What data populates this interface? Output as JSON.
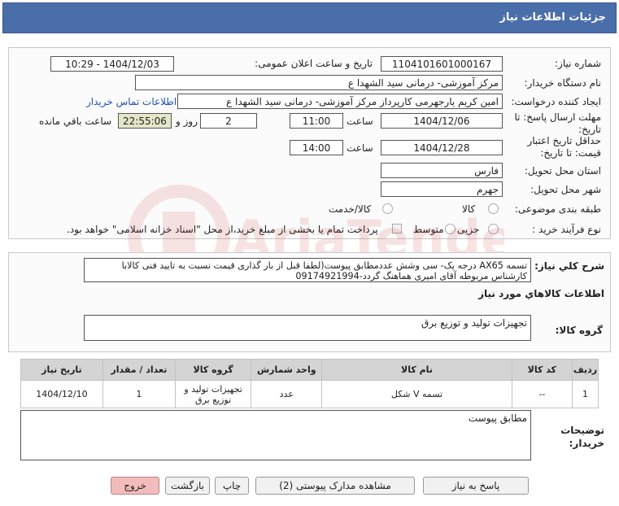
{
  "header": {
    "title": "جزئیات اطلاعات نیاز"
  },
  "form": {
    "need_number": {
      "label": "شماره نیاز:",
      "value": "1104101601000167"
    },
    "announce_datetime": {
      "label": "تاریخ و ساعت اعلان عمومی:",
      "value": "1404/12/03 - 10:29"
    },
    "buyer_org": {
      "label": "نام دستگاه خریدار:",
      "value": "مرکز آموزشی- درمانی سید الشهدا ع"
    },
    "requester": {
      "label": "ایجاد کننده درخواست:",
      "value": "امین کریم یارجهرمی کارپرداز مرکز آموزشی- درمانی سید الشهدا ع",
      "contact_link": "اطلاعات تماس خریدار"
    },
    "reply_deadline": {
      "label": "مهلت ارسال پاسخ: تا تاریخ:",
      "date": "1404/12/06",
      "time_label": "ساعت",
      "time": "11:00",
      "days": "2",
      "days_label": "روز و",
      "remaining": "22:55:06",
      "remaining_label": "ساعت باقي مانده"
    },
    "price_validity": {
      "label": "حداقل تاریخ اعتبار قیمت: تا تاریخ:",
      "date": "1404/12/28",
      "time_label": "ساعت",
      "time": "14:00"
    },
    "province": {
      "label": "استان محل تحویل:",
      "value": "فارس"
    },
    "city": {
      "label": "شهر محل تحویل:",
      "value": "جهرم"
    },
    "category": {
      "label": "طبقه بندی موضوعی:",
      "options": [
        "کالا",
        "کالا/خدمت"
      ]
    },
    "process": {
      "label": "نوع فرآیند خرید :",
      "options": [
        "جزیی",
        "متوسط"
      ],
      "payment_note": "پرداخت تمام یا بخشی از مبلغ خرید،از محل \"اسناد خزانه اسلامی\" خواهد بود."
    }
  },
  "summary": {
    "label": "شرح کلي نياز:",
    "line1": "تسمه AX65 درجه یک- سی وشش عددمطابق پیوست(لطفا قبل از بار گذاری قیمت نسبت به تایید فنی کالابا",
    "line2": "کارشناس مربوطه آقای امیری هماهنگ گردد-09174921994"
  },
  "goods_section": {
    "title": "اطلاعات کالاهاي مورد نياز"
  },
  "goods_group": {
    "label": "گروه کالا:",
    "value": "تجهیزات تولید و توزیع برق"
  },
  "table": {
    "headers": [
      "ردیف",
      "کد کالا",
      "نام کالا",
      "واحد شمارش",
      "گروه کالا",
      "تعداد / مقدار",
      "تاریخ نیاز"
    ],
    "rows": [
      {
        "row": "1",
        "code": "--",
        "name": "تسمه V شکل",
        "unit": "عدد",
        "group": "تجهیزات تولید و توزیع برق",
        "qty": "1",
        "date": "1404/12/10"
      }
    ]
  },
  "buyer_notes": {
    "label": "توضیحات خریدار:",
    "value": "مطابق پیوست"
  },
  "buttons": {
    "reply": "پاسخ به نیاز",
    "attachments": "مشاهده مدارک پیوستی (2)",
    "print": "چاپ",
    "back": "بازگشت",
    "exit": "خروج"
  },
  "colors": {
    "titlebar": "#4a6ea9",
    "exit_button": "#f2bcbc",
    "link": "#1f4fb8"
  },
  "watermark": {
    "text": "AriaTender.net"
  }
}
